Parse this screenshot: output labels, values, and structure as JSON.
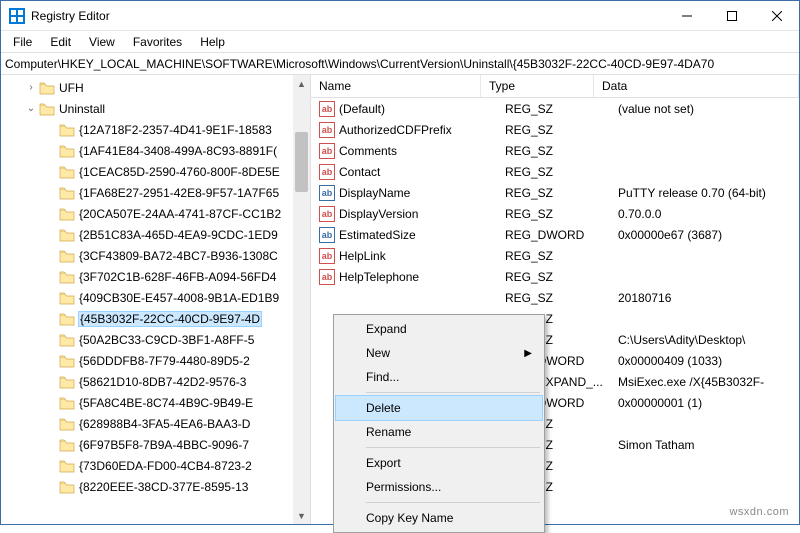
{
  "window": {
    "title": "Registry Editor",
    "min_tooltip": "Minimize",
    "max_tooltip": "Maximize",
    "close_tooltip": "Close"
  },
  "menu": {
    "file": "File",
    "edit": "Edit",
    "view": "View",
    "favorites": "Favorites",
    "help": "Help"
  },
  "address": "Computer\\HKEY_LOCAL_MACHINE\\SOFTWARE\\Microsoft\\Windows\\CurrentVersion\\Uninstall\\{45B3032F-22CC-40CD-9E97-4DA70",
  "tree": {
    "ufh": "UFH",
    "uninstall": "Uninstall",
    "items": [
      "{12A718F2-2357-4D41-9E1F-18583",
      "{1AF41E84-3408-499A-8C93-8891F(",
      "{1CEAC85D-2590-4760-800F-8DE5E",
      "{1FA68E27-2951-42E8-9F57-1A7F65",
      "{20CA507E-24AA-4741-87CF-CC1B2",
      "{2B51C83A-465D-4EA9-9CDC-1ED9",
      "{3CF43809-BA72-4BC7-B936-1308C",
      "{3F702C1B-628F-46FB-A094-56FD4",
      "{409CB30E-E457-4008-9B1A-ED1B9",
      "{45B3032F-22CC-40CD-9E97-4D",
      "{50A2BC33-C9CD-3BF1-A8FF-5",
      "{56DDDFB8-7F79-4480-89D5-2",
      "{58621D10-8DB7-42D2-9576-3",
      "{5FA8C4BE-8C74-4B9C-9B49-E",
      "{628988B4-3FA5-4EA6-BAA3-D",
      "{6F97B5F8-7B9A-4BBC-9096-7",
      "{73D60EDA-FD00-4CB4-8723-2",
      "{8220EEE-38CD-377E-8595-13"
    ],
    "selected_index": 9
  },
  "list": {
    "headers": {
      "name": "Name",
      "type": "Type",
      "data": "Data"
    },
    "rows": [
      {
        "icon": "str",
        "name": "(Default)",
        "type": "REG_SZ",
        "data": "(value not set)"
      },
      {
        "icon": "str",
        "name": "AuthorizedCDFPrefix",
        "type": "REG_SZ",
        "data": ""
      },
      {
        "icon": "str",
        "name": "Comments",
        "type": "REG_SZ",
        "data": ""
      },
      {
        "icon": "str",
        "name": "Contact",
        "type": "REG_SZ",
        "data": ""
      },
      {
        "icon": "bin",
        "name": "DisplayName",
        "type": "REG_SZ",
        "data": "PuTTY release 0.70 (64-bit)"
      },
      {
        "icon": "str",
        "name": "DisplayVersion",
        "type": "REG_SZ",
        "data": "0.70.0.0"
      },
      {
        "icon": "bin",
        "name": "EstimatedSize",
        "type": "REG_DWORD",
        "data": "0x00000e67 (3687)"
      },
      {
        "icon": "str",
        "name": "HelpLink",
        "type": "REG_SZ",
        "data": ""
      },
      {
        "icon": "str",
        "name": "HelpTelephone",
        "type": "REG_SZ",
        "data": ""
      },
      {
        "icon": "",
        "name": "",
        "type": "REG_SZ",
        "data": "20180716"
      },
      {
        "icon": "",
        "name": "",
        "type": "REG_SZ",
        "data": ""
      },
      {
        "icon": "",
        "name": "",
        "type": "REG_SZ",
        "data": "C:\\Users\\Adity\\Desktop\\"
      },
      {
        "icon": "",
        "name": "",
        "type": "REG_DWORD",
        "data": "0x00000409 (1033)"
      },
      {
        "icon": "",
        "name": "",
        "type": "REG_EXPAND_...",
        "data": "MsiExec.exe /X{45B3032F-"
      },
      {
        "icon": "",
        "name": "",
        "type": "REG_DWORD",
        "data": "0x00000001 (1)"
      },
      {
        "icon": "",
        "name": "",
        "type": "REG_SZ",
        "data": ""
      },
      {
        "icon": "",
        "name": "",
        "type": "REG_SZ",
        "data": "Simon Tatham"
      },
      {
        "icon": "",
        "name": "",
        "type": "REG_SZ",
        "data": ""
      },
      {
        "icon": "",
        "name": "",
        "type": "REG_SZ",
        "data": ""
      }
    ]
  },
  "context_menu": {
    "expand": "Expand",
    "new": "New",
    "find": "Find...",
    "delete": "Delete",
    "rename": "Rename",
    "export": "Export",
    "permissions": "Permissions...",
    "copy_key_name": "Copy Key Name"
  },
  "watermark": "wsxdn.com"
}
